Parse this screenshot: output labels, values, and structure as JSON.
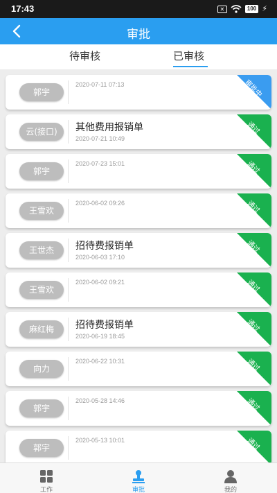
{
  "status_bar": {
    "time": "17:43",
    "battery": "100"
  },
  "nav": {
    "title": "审批"
  },
  "tabs": [
    {
      "label": "待审核",
      "active": false
    },
    {
      "label": "已审核",
      "active": true
    }
  ],
  "colors": {
    "primary": "#2a9ef0",
    "approved": "#1ab14f",
    "in_review": "#3a9cf0"
  },
  "items": [
    {
      "name": "郭宇",
      "title": "",
      "date": "2020-07-11 07:13",
      "status": "审批中"
    },
    {
      "name": "云(接口)",
      "title": "其他费用报销单",
      "date": "2020-07-21 10:49",
      "status": "通过"
    },
    {
      "name": "郭宇",
      "title": "",
      "date": "2020-07-23 15:01",
      "status": "通过"
    },
    {
      "name": "王雪欢",
      "title": "",
      "date": "2020-06-02 09:26",
      "status": "通过"
    },
    {
      "name": "王世杰",
      "title": "招待费报销单",
      "date": "2020-06-03 17:10",
      "status": "通过"
    },
    {
      "name": "王雪欢",
      "title": "",
      "date": "2020-06-02 09:21",
      "status": "通过"
    },
    {
      "name": "麻红梅",
      "title": "招待费报销单",
      "date": "2020-06-19 18:45",
      "status": "通过"
    },
    {
      "name": "向力",
      "title": "",
      "date": "2020-06-22 10:31",
      "status": "通过"
    },
    {
      "name": "郭宇",
      "title": "",
      "date": "2020-05-28 14:46",
      "status": "通过"
    },
    {
      "name": "郭宇",
      "title": "",
      "date": "2020-05-13 10:01",
      "status": "通过"
    }
  ],
  "bottom_tabs": [
    {
      "label": "工作",
      "icon": "grid-icon",
      "active": false
    },
    {
      "label": "审批",
      "icon": "stamp-icon",
      "active": true
    },
    {
      "label": "我的",
      "icon": "person-icon",
      "active": false
    }
  ]
}
